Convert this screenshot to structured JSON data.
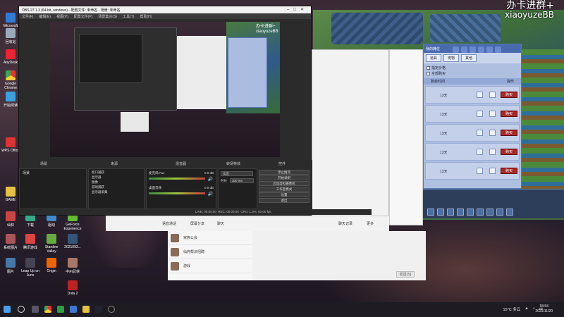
{
  "watermark": {
    "line1": "办卡进群+",
    "line2": "xiaoyuzeBB"
  },
  "desktop_icons": [
    "Microsoft Edge",
    "回收站",
    "AnyDesk",
    "Google Chrome",
    "开始阅读",
    "WPS Office",
    "GAME",
    "仙林",
    "Leap Up on Juno",
    "Origin",
    "中州武侠",
    "Dota 2",
    "下载",
    "驱动",
    "腾讯游戏",
    "GeForce Experience",
    "Stardew Valley",
    "2021093...",
    "系统图片",
    "图片"
  ],
  "obs": {
    "title": "OBS 27.1.3 (64-bit, windows) - 配置文件: 未命名 - 场景: 未命名",
    "menu": [
      "文件(F)",
      "编辑(E)",
      "视图(V)",
      "配置文件(P)",
      "场景集合(S)",
      "工具(T)",
      "帮助(H)"
    ],
    "panels": {
      "scenes": "场景",
      "sources": "来源",
      "mixer": "混音器",
      "transitions": "转场特效",
      "controls": "控件"
    },
    "scene_item": "场景",
    "source_items": [
      "窗口捕获",
      "显示器",
      "图像",
      "游戏捕获",
      "显示器采集"
    ],
    "mixer_tracks": [
      {
        "name": "麦克风/Aux",
        "db": "0.0 dB"
      },
      {
        "name": "桌面音频",
        "db": "0.0 dB"
      }
    ],
    "transition_value": "淡出",
    "duration_label": "时长",
    "duration_value": "300 ms",
    "controls_buttons": [
      "停止推流",
      "开始录制",
      "启动虚拟摄像机",
      "工作室模式",
      "设置",
      "退出"
    ],
    "status_live": "LIVE: 00:00:00",
    "status_rec": "REC: 00:00:00",
    "status_cpu": "CPU: 1.3%, 60.00 fps"
  },
  "chat": {
    "toolbar": [
      "聊天记录",
      "更多"
    ],
    "send": "发送(S)",
    "voice_label": "语音通话",
    "screen_label": "屏幕分享",
    "list": [
      "家族公会",
      "仙府帮派招聘",
      "游戏"
    ],
    "input_hint": "截图",
    "mode": "聊天"
  },
  "shop": {
    "title": "我的摊位",
    "tabs": [
      "道具",
      "宠物",
      "其他"
    ],
    "filters": [
      "指定价格",
      "全部购买"
    ],
    "col_desc": "剩余时间",
    "col_op": "操作",
    "rows": [
      "13天",
      "13天",
      "13天",
      "13天",
      "13天"
    ],
    "buy_label": "购买",
    "side_label": "出售",
    "side_sell_label": "购买"
  },
  "taskbar": {
    "weather": "15°C 多云",
    "lang": "中",
    "time": "18:54",
    "date": "2021/11/20"
  }
}
